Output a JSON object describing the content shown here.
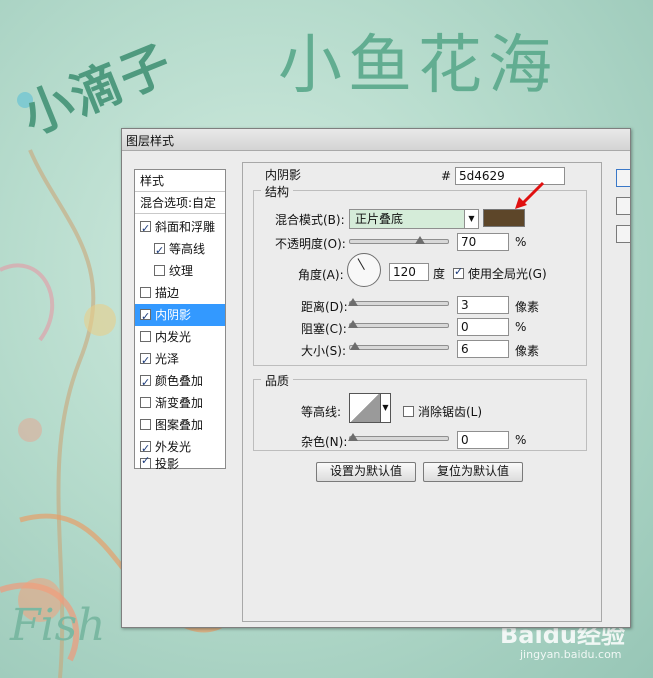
{
  "background": {
    "title_left": "小滴子",
    "title_right": "小鱼花海",
    "fish_text": "Fish",
    "watermark": "Baidu经验",
    "watermark_url": "jingyan.baidu.com"
  },
  "dialog": {
    "title": "图层样式",
    "left_panel": {
      "header": "样式",
      "blend_options": "混合选项:自定",
      "items": [
        {
          "label": "斜面和浮雕",
          "checked": true
        },
        {
          "label": "等高线",
          "checked": true
        },
        {
          "label": "纹理",
          "checked": false
        },
        {
          "label": "描边",
          "checked": false
        },
        {
          "label": "内阴影",
          "checked": true
        },
        {
          "label": "内发光",
          "checked": false
        },
        {
          "label": "光泽",
          "checked": true
        },
        {
          "label": "颜色叠加",
          "checked": true
        },
        {
          "label": "渐变叠加",
          "checked": false
        },
        {
          "label": "图案叠加",
          "checked": false
        },
        {
          "label": "外发光",
          "checked": true
        },
        {
          "label": "投影",
          "checked": true
        }
      ],
      "selected": "内阴影"
    },
    "inner_shadow": {
      "title": "内阴影",
      "hex_symbol": "#",
      "hex_value": "5d4629",
      "color": "#5d4629",
      "structure": {
        "label": "结构",
        "blend_mode_label": "混合模式(B):",
        "blend_mode_value": "正片叠底",
        "opacity_label": "不透明度(O):",
        "opacity_value": "70",
        "opacity_unit": "%",
        "angle_label": "角度(A):",
        "angle_value": "120",
        "angle_unit": "度",
        "global_light_label": "使用全局光(G)",
        "distance_label": "距离(D):",
        "distance_value": "3",
        "distance_unit": "像素",
        "choke_label": "阻塞(C):",
        "choke_value": "0",
        "choke_unit": "%",
        "size_label": "大小(S):",
        "size_value": "6",
        "size_unit": "像素"
      },
      "quality": {
        "label": "品质",
        "contour_label": "等高线:",
        "anti_alias_label": "消除锯齿(L)",
        "noise_label": "杂色(N):",
        "noise_value": "0",
        "noise_unit": "%"
      },
      "set_default": "设置为默认值",
      "reset_default": "复位为默认值"
    }
  }
}
